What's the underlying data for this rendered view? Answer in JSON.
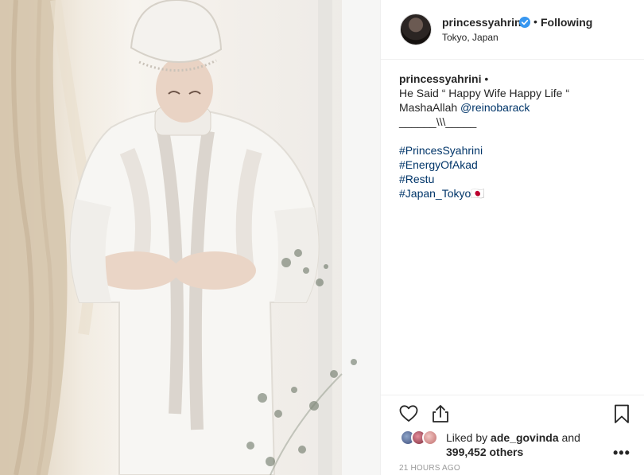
{
  "post": {
    "image_alt": "Man in white embroidered wedding attire adjusting his jacket",
    "header": {
      "username": "princessyahrini",
      "separator": "•",
      "follow_status": "Following",
      "location": "Tokyo, Japan"
    },
    "caption": {
      "username": "princessyahrini",
      "bullet": " •",
      "line1": "He Said “ Happy Wife Happy Life “",
      "line2_text": "MashaAllah ",
      "mention": "@reinobarack",
      "line3": "______\\\\\\_____",
      "hashtags": [
        "#PrincesSyahrini",
        "#EnergyOfAkad",
        "#Restu",
        "#Japan_Tokyo🇯🇵"
      ]
    },
    "likes": {
      "prefix": "Liked by ",
      "user": "ade_govinda",
      "middle": " and",
      "count": "399,452 others"
    },
    "more_label": "•••",
    "timestamp": "21 HOURS AGO"
  },
  "colors": {
    "link": "#003569",
    "verified": "#3897f0",
    "muted": "#999999",
    "text": "#262626"
  },
  "icons": [
    "verified-badge-icon",
    "heart-icon",
    "share-icon",
    "bookmark-icon",
    "more-options-icon"
  ]
}
